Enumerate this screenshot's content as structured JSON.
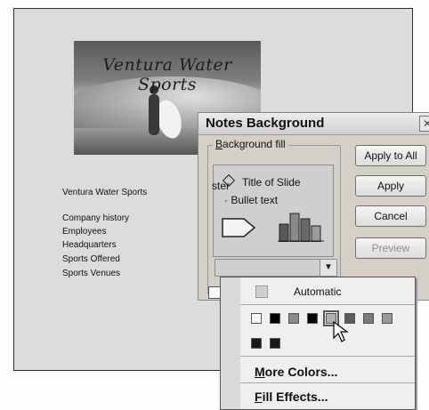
{
  "slide": {
    "title": "Ventura Water Sports"
  },
  "notes": {
    "heading": "Ventura Water Sports",
    "items": [
      "Company history",
      "Employees",
      "Headquarters",
      "Sports Offered",
      "Sports Venues"
    ]
  },
  "dialog": {
    "title": "Notes Background",
    "fill_group_label": "Background fill",
    "fill_group_label_access": "B",
    "preview": {
      "title_text": "Title of Slide",
      "bullet_text": "Bullet text"
    },
    "buttons": {
      "apply_all": "Apply to All",
      "apply": "Apply",
      "cancel": "Cancel",
      "preview": "Preview"
    },
    "master_partial": "ster"
  },
  "color_menu": {
    "automatic": "Automatic",
    "more_colors": "More Colors...",
    "fill_effects": "Fill Effects...",
    "swatch_row_1": [
      "#ffffff",
      "#000000",
      "#8a8a8a",
      "#000000",
      "#b0b0b0",
      "#5c5c5c",
      "#7a7a7a",
      "#9a9a9a"
    ],
    "swatch_row_2": [
      "#1a1a1a",
      "#1a1a1a"
    ]
  },
  "icons": {
    "close": "close-icon",
    "dropdown": "chevron-down-icon",
    "cursor": "arrow-cursor-icon"
  }
}
